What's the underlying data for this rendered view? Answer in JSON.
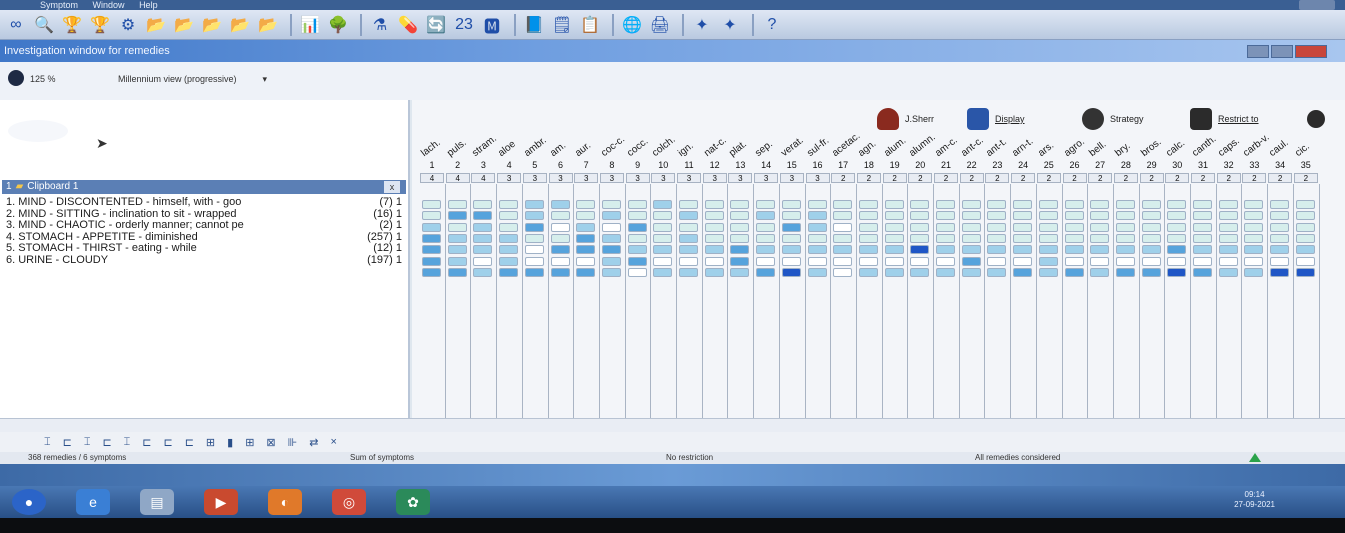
{
  "menubar": {
    "items": [
      "Symptom",
      "Window",
      "Help"
    ]
  },
  "toolbar": {
    "icons": [
      "glasses-icon",
      "search-icon",
      "trophy-icon",
      "trophy-outline-icon",
      "network-icon",
      "folder-1-icon",
      "folder-2-icon",
      "folder-3-icon",
      "folder-4-icon",
      "folder-5-icon",
      "chart-icon",
      "tree-icon",
      "flask-icon",
      "capsule-icon",
      "refresh-icon",
      "number-23-icon",
      "letter-icon",
      "book-icon",
      "notes-icon",
      "list-icon",
      "globe-icon",
      "printer-icon",
      "theme-1-icon",
      "theme-2-icon",
      "help-icon"
    ],
    "glyphs": [
      "∞",
      "🔍",
      "🏆",
      "🏆",
      "⚙",
      "📂",
      "📂",
      "📂",
      "📂",
      "📂",
      "📊",
      "🌳",
      "⚗",
      "💊",
      "🔄",
      "23",
      "🅼",
      "📘",
      "🗒",
      "📋",
      "🌐",
      "🖨",
      "✦",
      "✦",
      "?"
    ],
    "help_label": "?"
  },
  "window": {
    "title": "Investigation window for remedies"
  },
  "options": {
    "zoom": "125 %",
    "view": "Millennium view (progressive)",
    "view_arrow": "▾"
  },
  "right_controls": {
    "user": "J.Sherr",
    "display": "Display",
    "strategy": "Strategy",
    "restrict": "Restrict to"
  },
  "clipboard": {
    "title": "Clipboard 1",
    "number": "1",
    "close": "x",
    "rubrics": [
      {
        "text": "1. MIND - DISCONTENTED - himself, with - goo",
        "count": "(7) 1"
      },
      {
        "text": "2. MIND - SITTING - inclination to sit - wrapped",
        "count": "(16) 1"
      },
      {
        "text": "3. MIND - CHAOTIC - orderly manner; cannot pe",
        "count": "(2) 1"
      },
      {
        "text": "4. STOMACH - APPETITE - diminished",
        "count": "(257) 1"
      },
      {
        "text": "5. STOMACH - THIRST - eating - while",
        "count": "(12) 1"
      },
      {
        "text": "6. URINE - CLOUDY",
        "count": "(197) 1"
      }
    ]
  },
  "remedies": {
    "names": [
      "lach.",
      "puls.",
      "stram.",
      "aloe",
      "ambr.",
      "am.",
      "aur.",
      "coc-c.",
      "cocc.",
      "colch.",
      "ign.",
      "nat-c.",
      "plat.",
      "sep.",
      "verat.",
      "sul-fr.",
      "acetac.",
      "agn.",
      "alum.",
      "alumn.",
      "am-c.",
      "ant-c.",
      "ant-t.",
      "arn-t.",
      "ars.",
      "agro.",
      "bell.",
      "bry.",
      "bros.",
      "calc.",
      "canth.",
      "caps.",
      "carb-v.",
      "caul.",
      "cic."
    ],
    "numbers": [
      "1",
      "2",
      "3",
      "4",
      "5",
      "6",
      "7",
      "8",
      "9",
      "10",
      "11",
      "12",
      "13",
      "14",
      "15",
      "16",
      "17",
      "18",
      "19",
      "20",
      "21",
      "22",
      "23",
      "24",
      "25",
      "26",
      "27",
      "28",
      "29",
      "30",
      "31",
      "32",
      "33",
      "34",
      "35"
    ],
    "scores": [
      "4",
      "4",
      "4",
      "3",
      "3",
      "3",
      "3",
      "3",
      "3",
      "3",
      "3",
      "3",
      "3",
      "3",
      "3",
      "3",
      "2",
      "2",
      "2",
      "2",
      "2",
      "2",
      "2",
      "2",
      "2",
      "2",
      "2",
      "2",
      "2",
      "2",
      "2",
      "2",
      "2",
      "2",
      "2"
    ]
  },
  "grid_cells": [
    [
      1,
      1,
      1,
      1,
      2,
      2,
      1,
      1,
      1,
      2,
      1,
      1,
      1,
      1,
      1,
      1,
      1,
      1,
      1,
      1,
      1,
      1,
      1,
      1,
      1,
      1,
      1,
      1,
      1,
      1,
      1,
      1,
      1,
      1,
      1
    ],
    [
      1,
      3,
      3,
      1,
      2,
      1,
      1,
      2,
      1,
      1,
      2,
      1,
      1,
      2,
      1,
      2,
      1,
      1,
      1,
      1,
      1,
      1,
      1,
      1,
      1,
      1,
      1,
      1,
      1,
      1,
      1,
      1,
      1,
      1,
      1
    ],
    [
      2,
      1,
      2,
      1,
      3,
      0,
      2,
      0,
      3,
      1,
      1,
      1,
      1,
      1,
      3,
      2,
      0,
      1,
      1,
      1,
      1,
      1,
      1,
      1,
      1,
      1,
      1,
      1,
      1,
      1,
      1,
      1,
      1,
      1,
      1
    ],
    [
      3,
      2,
      2,
      2,
      1,
      1,
      3,
      2,
      1,
      1,
      2,
      1,
      1,
      1,
      1,
      1,
      1,
      1,
      1,
      1,
      1,
      1,
      1,
      1,
      1,
      1,
      1,
      1,
      1,
      1,
      1,
      1,
      1,
      1,
      1
    ],
    [
      3,
      2,
      2,
      2,
      0,
      3,
      3,
      3,
      2,
      2,
      2,
      2,
      3,
      2,
      2,
      2,
      2,
      2,
      2,
      4,
      2,
      2,
      2,
      2,
      2,
      2,
      2,
      2,
      2,
      3,
      2,
      2,
      2,
      2,
      2
    ],
    [
      3,
      2,
      0,
      2,
      0,
      0,
      0,
      2,
      3,
      0,
      0,
      0,
      3,
      0,
      0,
      0,
      0,
      0,
      0,
      0,
      0,
      3,
      0,
      0,
      2,
      0,
      0,
      0,
      0,
      0,
      0,
      0,
      0,
      0,
      0
    ],
    [
      3,
      3,
      2,
      3,
      3,
      3,
      3,
      2,
      0,
      2,
      2,
      2,
      2,
      3,
      4,
      2,
      0,
      2,
      2,
      2,
      2,
      2,
      2,
      3,
      2,
      3,
      2,
      3,
      3,
      4,
      3,
      2,
      2,
      4,
      4
    ]
  ],
  "bottom_tools": {
    "glyphs": [
      "⌶",
      "⊏",
      "⌶",
      "⊏",
      "⌶",
      "⊏",
      "⊏",
      "⊏",
      "⊞",
      "▮",
      "⊞",
      "⊠",
      "⊪",
      "⇄",
      "×"
    ]
  },
  "status": {
    "left": "368 remedies / 6 symptoms",
    "sum": "Sum of symptoms",
    "restriction": "No restriction",
    "considered": "All remedies considered"
  },
  "taskbar": {
    "apps": [
      "start-orb",
      "ie-icon",
      "explorer-icon",
      "media-icon",
      "firefox-icon",
      "chrome-icon",
      "app-icon"
    ],
    "glyphs": [
      "●",
      "e",
      "▤",
      "▶",
      "◐",
      "◎",
      "✿"
    ],
    "time": "09:14",
    "date": "27-09-2021"
  },
  "colors": {
    "light": "#d6eeec",
    "mid": "#9fd0ea",
    "strong": "#56a3dc",
    "deep": "#1f56c6"
  }
}
